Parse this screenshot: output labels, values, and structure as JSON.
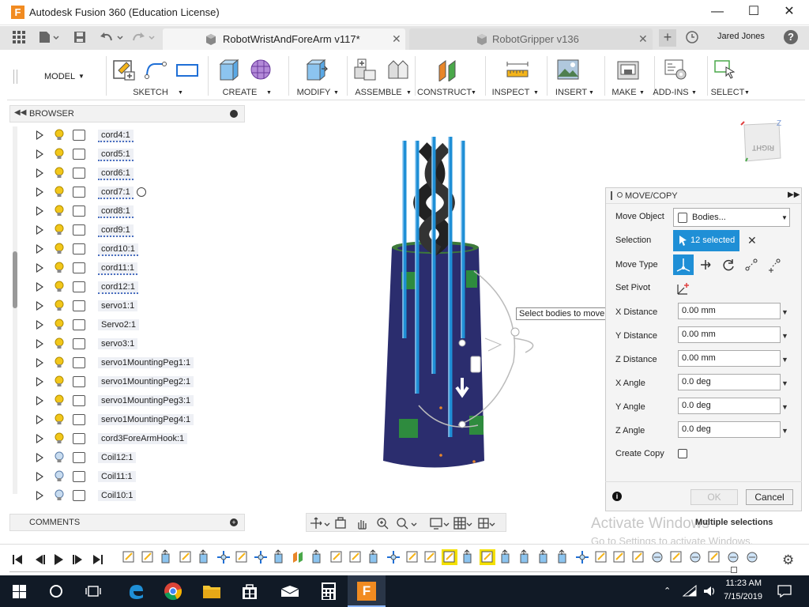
{
  "window": {
    "app_logo": "F",
    "title": "Autodesk Fusion 360 (Education License)"
  },
  "tabs": {
    "active": "RobotWristAndForeArm v117*",
    "inactive": "RobotGripper v136",
    "user": "Jared Jones"
  },
  "toolbar": {
    "workspace": "MODEL",
    "groups": [
      "SKETCH",
      "CREATE",
      "MODIFY",
      "ASSEMBLE",
      "CONSTRUCT",
      "INSPECT",
      "INSERT",
      "MAKE",
      "ADD-INS",
      "SELECT"
    ]
  },
  "browser": {
    "title": "BROWSER",
    "items": [
      {
        "name": "cord4:1",
        "bulb": "on",
        "link": true
      },
      {
        "name": "cord5:1",
        "bulb": "on",
        "link": true
      },
      {
        "name": "cord6:1",
        "bulb": "on",
        "link": true
      },
      {
        "name": "cord7:1",
        "bulb": "on",
        "link": true
      },
      {
        "name": "cord8:1",
        "bulb": "on",
        "link": true
      },
      {
        "name": "cord9:1",
        "bulb": "on",
        "link": true
      },
      {
        "name": "cord10:1",
        "bulb": "on",
        "link": true
      },
      {
        "name": "cord11:1",
        "bulb": "on",
        "link": true
      },
      {
        "name": "cord12:1",
        "bulb": "on",
        "link": true
      },
      {
        "name": "servo1:1",
        "bulb": "on",
        "link": false
      },
      {
        "name": "Servo2:1",
        "bulb": "on",
        "link": false
      },
      {
        "name": "servo3:1",
        "bulb": "on",
        "link": false
      },
      {
        "name": "servo1MountingPeg1:1",
        "bulb": "on",
        "link": false
      },
      {
        "name": "servo1MountingPeg2:1",
        "bulb": "on",
        "link": false
      },
      {
        "name": "servo1MountingPeg3:1",
        "bulb": "on",
        "link": false
      },
      {
        "name": "servo1MountingPeg4:1",
        "bulb": "on",
        "link": false
      },
      {
        "name": "cord3ForeArmHook:1",
        "bulb": "on",
        "link": false
      },
      {
        "name": "Coil12:1",
        "bulb": "off",
        "link": false
      },
      {
        "name": "Coil11:1",
        "bulb": "off",
        "link": false
      },
      {
        "name": "Coil10:1",
        "bulb": "off",
        "link": false
      }
    ],
    "comments": "COMMENTS"
  },
  "viewcube": {
    "face": "RIGHT",
    "axis": "Z"
  },
  "viewport": {
    "tooltip": "Select bodies to move",
    "status": "Multiple selections",
    "watermark_title": "Activate Windows",
    "watermark_sub": "Go to Settings to activate Windows."
  },
  "panel": {
    "title": "MOVE/COPY",
    "move_object_label": "Move Object",
    "move_object_value": "Bodies...",
    "selection_label": "Selection",
    "selection_value": "12 selected",
    "move_type_label": "Move Type",
    "set_pivot_label": "Set Pivot",
    "fields": [
      {
        "label": "X Distance",
        "value": "0.00 mm"
      },
      {
        "label": "Y Distance",
        "value": "0.00 mm"
      },
      {
        "label": "Z Distance",
        "value": "0.00 mm"
      },
      {
        "label": "X Angle",
        "value": "0.0 deg"
      },
      {
        "label": "Y Angle",
        "value": "0.0 deg"
      },
      {
        "label": "Z Angle",
        "value": "0.0 deg"
      }
    ],
    "create_copy_label": "Create Copy",
    "ok": "OK",
    "cancel": "Cancel"
  },
  "taskbar": {
    "time": "11:23 AM",
    "date": "7/15/2019",
    "fusion_logo": "F"
  },
  "colors": {
    "model_body": "#2b2d6e",
    "accent_blue": "#1f8fd6",
    "fusion_orange": "#f18b21",
    "green_block": "#2e8b3e"
  }
}
